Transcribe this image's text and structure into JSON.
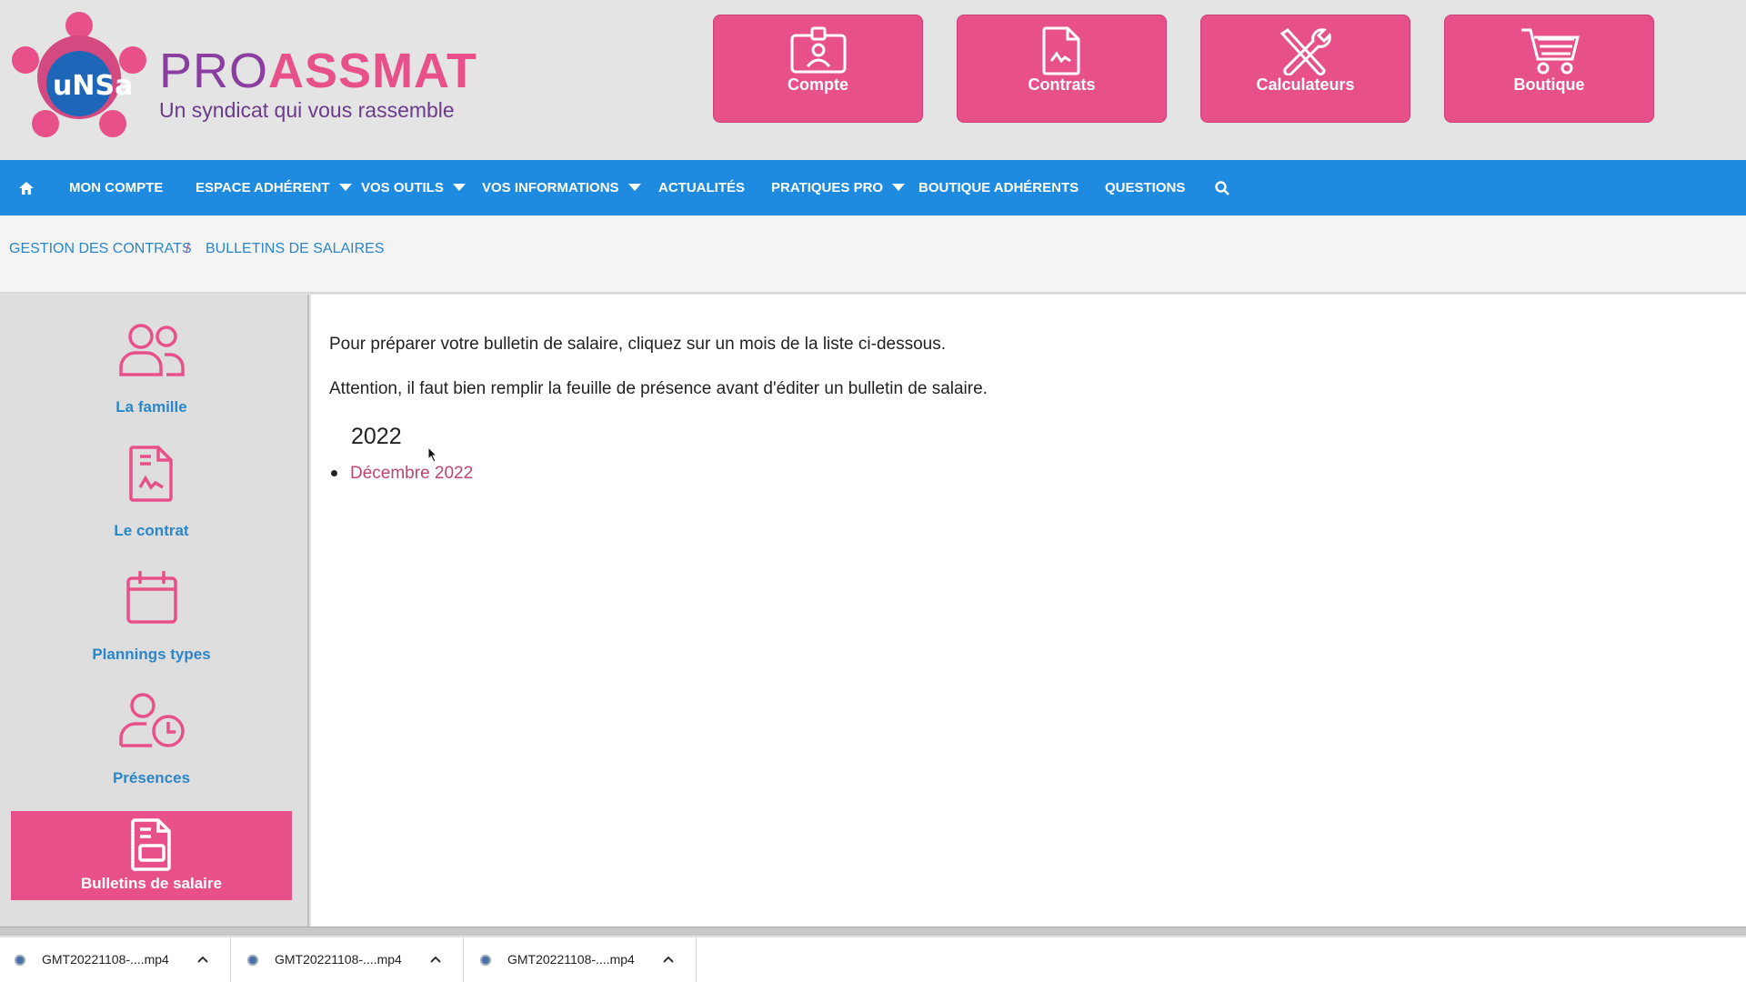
{
  "header": {
    "logo_text": "uNSa",
    "brand_pro": "PRO",
    "brand_assmat": "ASSMAT",
    "tagline": "Un syndicat qui vous rassemble",
    "buttons": [
      {
        "label": "Compte",
        "icon": "id-badge-icon"
      },
      {
        "label": "Contrats",
        "icon": "contract-document-icon"
      },
      {
        "label": "Calculateurs",
        "icon": "tools-icon"
      },
      {
        "label": "Boutique",
        "icon": "cart-icon"
      }
    ]
  },
  "nav": {
    "home_icon": "home-icon",
    "items": [
      {
        "label": "MON COMPTE"
      },
      {
        "label": "ESPACE ADHÉRENT",
        "dropdown": true
      },
      {
        "label": "VOS OUTILS",
        "dropdown": true
      },
      {
        "label": "VOS INFORMATIONS",
        "dropdown": true
      },
      {
        "label": "ACTUALITÉS"
      },
      {
        "label": "PRATIQUES PRO",
        "dropdown": true
      },
      {
        "label": "BOUTIQUE ADHÉRENTS"
      },
      {
        "label": "QUESTIONS"
      }
    ],
    "search_icon": "search-icon"
  },
  "breadcrumb": {
    "items": [
      "GESTION DES CONTRATS",
      "BULLETINS DE SALAIRES"
    ],
    "separator": "/"
  },
  "sidebar": {
    "items": [
      {
        "label": "La famille",
        "icon": "family-icon"
      },
      {
        "label": "Le contrat",
        "icon": "contract-icon"
      },
      {
        "label": "Plannings types",
        "icon": "calendar-icon"
      },
      {
        "label": "Présences",
        "icon": "attendance-clock-icon"
      },
      {
        "label": "Bulletins de salaire",
        "icon": "payslip-icon",
        "active": true
      }
    ]
  },
  "main": {
    "intro": "Pour préparer votre bulletin de salaire, cliquez sur un mois de la liste ci-dessous.",
    "warning": "Attention, il faut bien remplir la feuille de présence avant d'éditer un bulletin de salaire.",
    "year": "2022",
    "months": [
      "Décembre 2022"
    ]
  },
  "downloads": [
    {
      "name": "GMT20221108-....mp4"
    },
    {
      "name": "GMT20221108-....mp4"
    },
    {
      "name": "GMT20221108-....mp4"
    }
  ],
  "colors": {
    "pink": "#e8508a",
    "blue": "#1e8be0",
    "purple": "#8a3fa0"
  }
}
